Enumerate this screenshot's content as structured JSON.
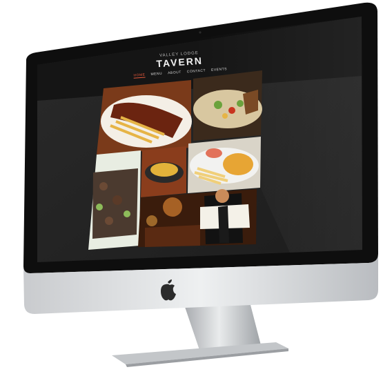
{
  "site": {
    "logo_small": "VALLEY LODGE",
    "logo_big": "TAVERN"
  },
  "nav": {
    "items": [
      {
        "label": "HOME",
        "active": true
      },
      {
        "label": "MENU",
        "active": false
      },
      {
        "label": "ABOUT",
        "active": false
      },
      {
        "label": "CONTACT",
        "active": false
      },
      {
        "label": "EVENTS",
        "active": false
      }
    ]
  },
  "colors": {
    "accent": "#e2573b",
    "screen_bg": "#232323",
    "bezel": "#0d0d0d",
    "aluminum": "#d4d6d8"
  },
  "icons": {
    "brand": "apple-logo-icon"
  }
}
